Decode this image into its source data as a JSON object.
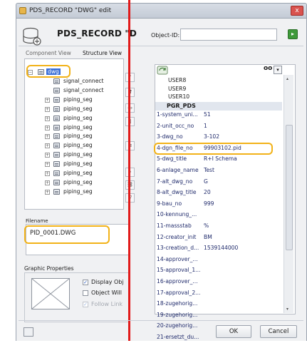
{
  "window": {
    "title": "PDS_RECORD \"DWG\" edit",
    "close_label": "x"
  },
  "header": {
    "title": "PDS_RECORD \"D",
    "object_id_label": "Object-ID:",
    "object_id_value": ""
  },
  "tabs": [
    {
      "label": "Component View"
    },
    {
      "label": "Structure View"
    }
  ],
  "tree": {
    "root_label": "dwg",
    "items": [
      {
        "label": "signal_connect",
        "expandable": false
      },
      {
        "label": "signal_connect",
        "expandable": false
      },
      {
        "label": "piping_seg",
        "expandable": true
      },
      {
        "label": "piping_seg",
        "expandable": true
      },
      {
        "label": "piping_seg",
        "expandable": true
      },
      {
        "label": "piping_seg",
        "expandable": true
      },
      {
        "label": "piping_seg",
        "expandable": true
      },
      {
        "label": "piping_seg",
        "expandable": true
      },
      {
        "label": "piping_seg",
        "expandable": true
      },
      {
        "label": "piping_seg",
        "expandable": true
      },
      {
        "label": "piping_seg",
        "expandable": true
      },
      {
        "label": "piping_seg",
        "expandable": true
      },
      {
        "label": "piping_seg",
        "expandable": true
      }
    ]
  },
  "filename": {
    "label": "Filename",
    "value": "PID_0001.DWG"
  },
  "graphic_properties": {
    "label": "Graphic Properties",
    "options": [
      {
        "label": "Display Obj",
        "checked": true,
        "enabled": true
      },
      {
        "label": "Object Will",
        "checked": false,
        "enabled": true
      },
      {
        "label": "Follow Link",
        "checked": true,
        "enabled": false
      }
    ]
  },
  "attributes": {
    "toolbar_right": "oo",
    "rows_before_section": [
      {
        "key": "USER8",
        "value": ""
      },
      {
        "key": "USER9",
        "value": ""
      },
      {
        "key": "USER10",
        "value": ""
      }
    ],
    "section_label": "PGR_PDS",
    "rows": [
      {
        "key": "1-system_uni...",
        "value": "51"
      },
      {
        "key": "2-unit_occ_no",
        "value": "1"
      },
      {
        "key": "3-dwg_no",
        "value": "3-102"
      },
      {
        "key": "4-dgn_file_no",
        "value": "99903102.pid"
      },
      {
        "key": "5-dwg_title",
        "value": "R+I Schema"
      },
      {
        "key": "6-anlage_name",
        "value": "Test"
      },
      {
        "key": "7-alt_dwg_no",
        "value": "G"
      },
      {
        "key": "8-alt_dwg_title",
        "value": "20"
      },
      {
        "key": "9-bau_no",
        "value": "999"
      },
      {
        "key": "10-kennung_...",
        "value": ""
      },
      {
        "key": "11-massstab",
        "value": "%"
      },
      {
        "key": "12-creator_init",
        "value": "BM"
      },
      {
        "key": "13-creation_d...",
        "value": "1539144000"
      },
      {
        "key": "14-approver_...",
        "value": ""
      },
      {
        "key": "15-approval_1...",
        "value": ""
      },
      {
        "key": "16-approver_...",
        "value": ""
      },
      {
        "key": "17-approval_2...",
        "value": ""
      },
      {
        "key": "18-zugehorig...",
        "value": ""
      },
      {
        "key": "19-zugehorig...",
        "value": ""
      },
      {
        "key": "20-zugehorig...",
        "value": ""
      },
      {
        "key": "21-ersetzt_du...",
        "value": ""
      }
    ]
  },
  "footer": {
    "ok_label": "OK",
    "cancel_label": "Cancel"
  },
  "colors": {
    "selection": "#3a6fd8",
    "highlight": "#f2b218",
    "red_line": "#e11a1a",
    "accent_green": "#3e9a3a"
  },
  "icons": [
    "database-icon",
    "tree-node-icon",
    "refresh-icon",
    "dropdown-icon",
    "checkmark-icon"
  ]
}
